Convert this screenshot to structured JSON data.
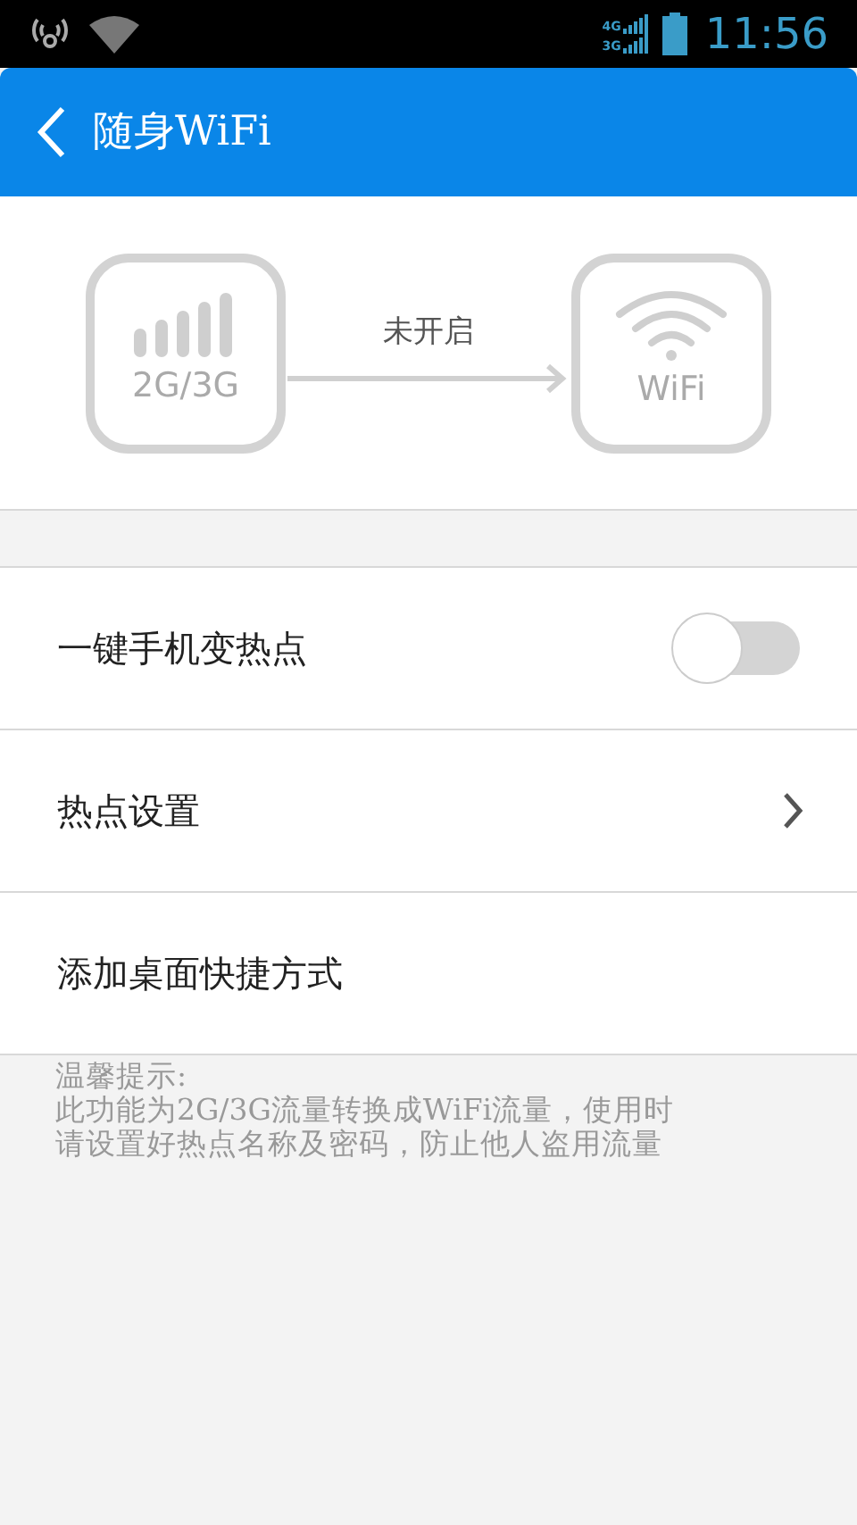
{
  "status_bar": {
    "network_top": "4G",
    "network_bottom": "3G",
    "time": "11:56"
  },
  "header": {
    "title": "随身WiFi"
  },
  "diagram": {
    "source_label": "2G/3G",
    "state_label": "未开启",
    "target_label": "WiFi"
  },
  "rows": [
    {
      "kind": "toggle",
      "label": "一键手机变热点",
      "on": false
    },
    {
      "kind": "link",
      "label": "热点设置"
    },
    {
      "kind": "plain",
      "label": "添加桌面快捷方式"
    }
  ],
  "tip": {
    "title": "温馨提示:",
    "lines": [
      "此功能为2G/3G流量转换成WiFi流量，使用时",
      "请设置好热点名称及密码，防止他人盗用流量"
    ]
  }
}
